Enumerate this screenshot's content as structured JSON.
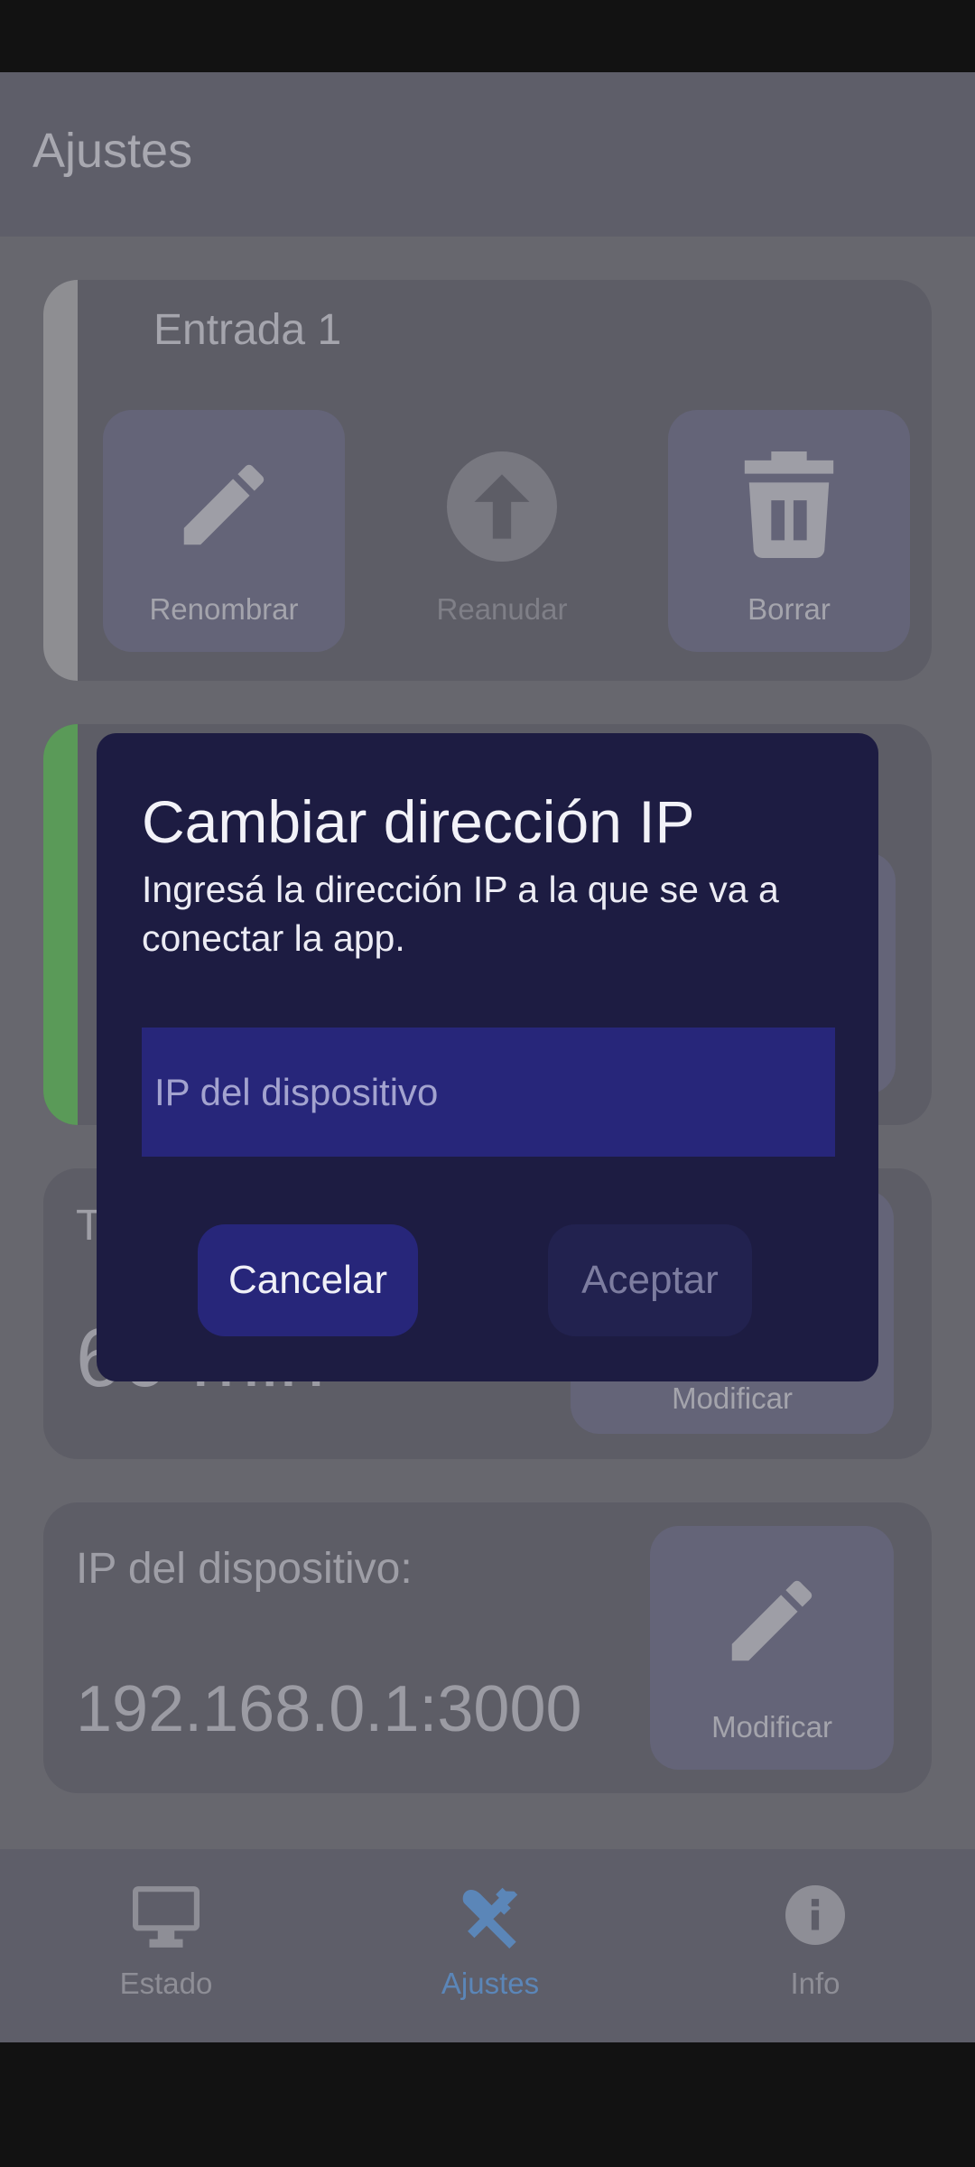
{
  "app": {
    "title": "Ajustes"
  },
  "entrada1": {
    "title": "Entrada 1",
    "rename_label": "Renombrar",
    "resume_label": "Reanudar",
    "delete_label": "Borrar",
    "stripe_color": "#8e8e92"
  },
  "card2": {
    "stripe_color": "#5a9a58"
  },
  "tiempo": {
    "title_partial": "T",
    "value_partial": "60 min",
    "modify_label": "Modificar"
  },
  "ip_card": {
    "label": "IP del dispositivo:",
    "value": "192.168.0.1:3000",
    "modify_label": "Modificar"
  },
  "dialog": {
    "title": "Cambiar dirección IP",
    "message": "Ingresá la dirección IP a la que se va a conectar la app.",
    "input_placeholder": "IP del dispositivo",
    "cancel_label": "Cancelar",
    "accept_label": "Aceptar"
  },
  "nav": {
    "items": [
      {
        "label": "Estado",
        "icon": "monitor-icon",
        "active": false
      },
      {
        "label": "Ajustes",
        "icon": "tools-icon",
        "active": true
      },
      {
        "label": "Info",
        "icon": "info-icon",
        "active": false
      }
    ],
    "active_color": "#5b86b8"
  }
}
